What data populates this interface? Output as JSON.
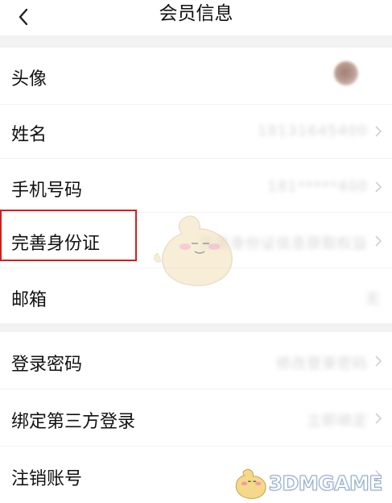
{
  "header": {
    "title": "会员信息",
    "back_icon": "chevron-left-icon"
  },
  "section1": [
    {
      "label": "头像",
      "type": "avatar"
    },
    {
      "label": "姓名",
      "value": "18131645400",
      "chevron": true
    },
    {
      "label": "手机号码",
      "value": "181*****400",
      "chevron": true
    },
    {
      "label": "完善身份证",
      "value": "完善身份证信息获取权益",
      "chevron": true
    },
    {
      "label": "邮箱",
      "value": "无",
      "chevron": false
    }
  ],
  "section2": [
    {
      "label": "登录密码",
      "value": "修改登录密码",
      "chevron": true
    },
    {
      "label": "绑定第三方登录",
      "value": "立即绑定",
      "chevron": true
    },
    {
      "label": "注销账号",
      "value": "",
      "chevron": true
    }
  ],
  "watermark": {
    "text": "3DMGAME"
  },
  "colors": {
    "highlight": "#d11e1e",
    "background": "#f2f2f2",
    "row": "#ffffff"
  }
}
